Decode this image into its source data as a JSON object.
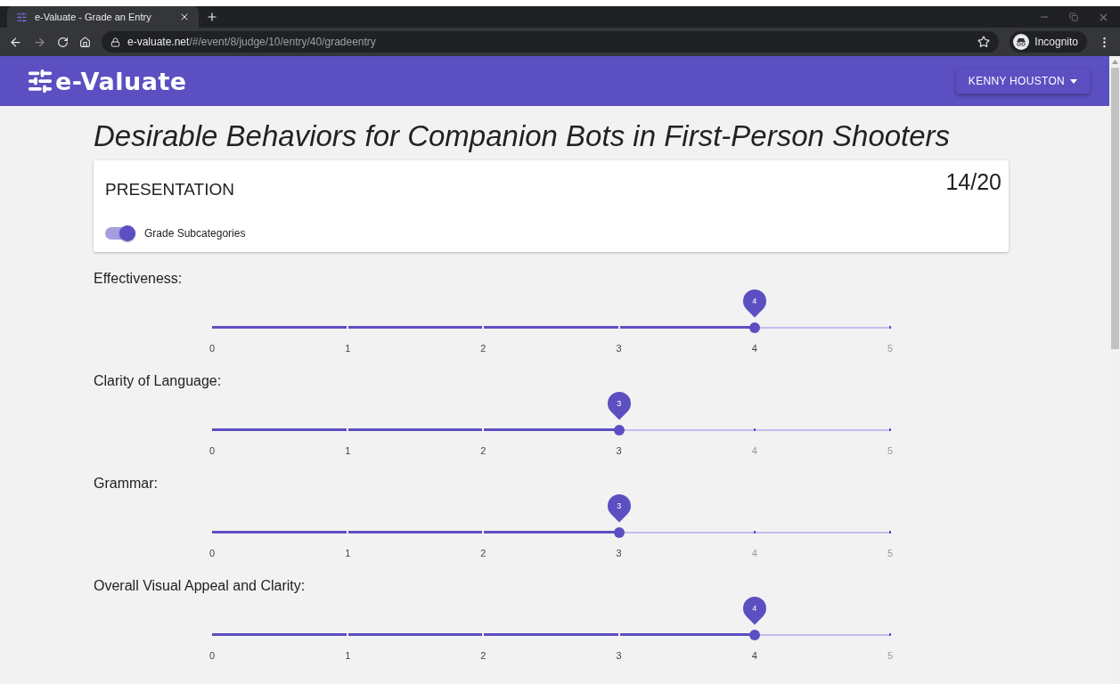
{
  "browser": {
    "tab_title": "e-Valuate - Grade an Entry",
    "url_host": "e-valuate.net",
    "url_path": "/#/event/8/judge/10/entry/40/gradeentry",
    "profile": "Incognito"
  },
  "app": {
    "logo": "e-Valuate",
    "user_menu": "KENNY HOUSTON"
  },
  "title": "Desirable Behaviors for Companion Bots in First-Person Shooters",
  "category": {
    "name": "PRESENTATION",
    "score": "14/20",
    "toggle": {
      "label": "Grade Subcategories",
      "on": true
    }
  },
  "subcategories": [
    {
      "label": "Effectiveness:",
      "value": "4",
      "level": 0.8,
      "marks": [
        "0",
        "1",
        "2",
        "3",
        "4",
        "5"
      ]
    },
    {
      "label": "Clarity of Language:",
      "value": "3",
      "level": 0.6,
      "marks": [
        "0",
        "1",
        "2",
        "3",
        "4",
        "5"
      ]
    },
    {
      "label": "Grammar:",
      "value": "3",
      "level": 0.6,
      "marks": [
        "0",
        "1",
        "2",
        "3",
        "4",
        "5"
      ]
    },
    {
      "label": "Overall Visual Appeal and Clarity:",
      "value": "4",
      "level": 0.8,
      "marks": [
        "0",
        "1",
        "2",
        "3",
        "4",
        "5"
      ]
    }
  ]
}
